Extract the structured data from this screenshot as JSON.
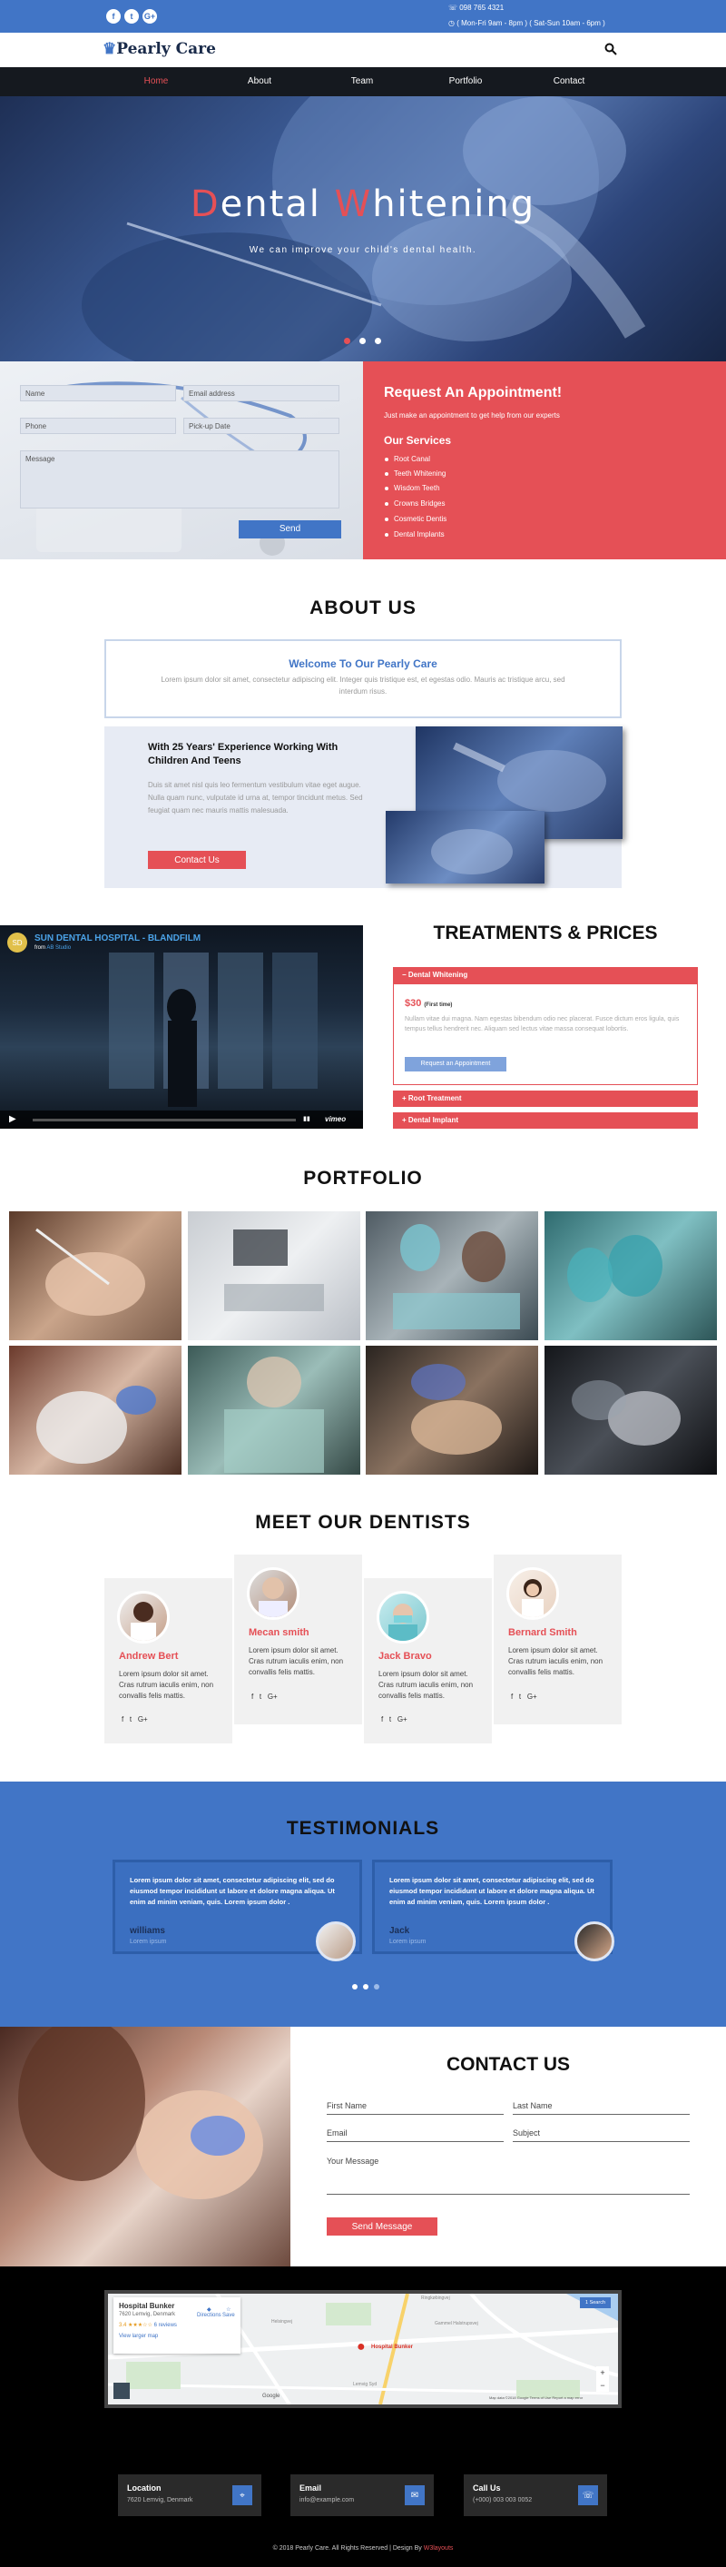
{
  "topbar": {
    "phone": "098 765 4321",
    "hours": "( Mon-Fri 9am - 8pm ) ( Sat-Sun 10am - 6pm )",
    "social": [
      "f",
      "t",
      "G+"
    ]
  },
  "header": {
    "logo": "Pearly Care",
    "search_icon": "search-icon"
  },
  "nav": {
    "items": [
      "Home",
      "About",
      "Team",
      "Portfolio",
      "Contact"
    ],
    "active": "Home"
  },
  "hero": {
    "title_first_letter_1": "D",
    "title_rest_1": "ental ",
    "title_first_letter_2": "W",
    "title_rest_2": "hitening",
    "subtitle": "We can improve your child's dental health."
  },
  "appointment": {
    "name_placeholder": "Name",
    "email_placeholder": "Email address",
    "phone_placeholder": "Phone",
    "pickup_placeholder": "Pick-up Date",
    "message_placeholder": "Message",
    "send_label": "Send",
    "heading": "Request An Appointment!",
    "subheading": "Just make an appointment to get help from our experts",
    "services_title": "Our Services",
    "services": [
      "Root Canal",
      "Teeth Whitening",
      "Wisdom Teeth",
      "Crowns Bridges",
      "Cosmetic Dentis",
      "Dental Implants"
    ]
  },
  "about": {
    "title": "ABOUT US",
    "welcome_title": "Welcome To Our Pearly Care",
    "welcome_text": "Lorem ipsum dolor sit amet, consectetur adipiscing elit. Integer quis tristique est, et egestas odio. Mauris ac tristique arcu, sed interdum risus.",
    "experience_title": "With 25 Years' Experience Working With Children And Teens",
    "experience_text": "Duis sit amet nisl quis leo fermentum vestibulum vitae eget augue. Nulla quam nunc, vulputate id urna at, tempor tincidunt metus. Sed feugiat quam nec mauris mattis malesuada.",
    "contact_label": "Contact Us"
  },
  "video": {
    "channel": "SUN DENTAL HOSPITAL - BLANDFILM",
    "from": "from",
    "from_name": "AB Studio",
    "brand": "vimeo"
  },
  "treatments": {
    "title": "TREATMENTS & PRICES",
    "items": [
      {
        "label": "Dental Whitening",
        "open": true
      },
      {
        "label": "Root Treatment",
        "open": false
      },
      {
        "label": "Dental Implant",
        "open": false
      }
    ],
    "price": "$30",
    "price_note": "(First time)",
    "desc": "Nullam vitae dui magna. Nam egestas bibendum odio nec placerat. Fusce dictum eros ligula, quis tempus tellus hendrerit nec. Aliquam sed lectus vitae massa consequat lobortis.",
    "request_label": "Request an Appointment"
  },
  "portfolio": {
    "title": "PORTFOLIO"
  },
  "dentists": {
    "title": "MEET OUR DENTISTS",
    "text": "Lorem ipsum dolor sit amet. Cras rutrum iaculis enim, non convallis felis mattis.",
    "list": [
      {
        "name": "Andrew Bert"
      },
      {
        "name": "Mecan smith"
      },
      {
        "name": "Jack Bravo"
      },
      {
        "name": "Bernard Smith"
      }
    ],
    "social": [
      "f",
      "t",
      "G+"
    ]
  },
  "testimonials": {
    "title": "TESTIMONIALS",
    "items": [
      {
        "text": "Lorem ipsum dolor sit amet, consectetur adipiscing elit, sed do eiusmod tempor incididunt ut labore et dolore magna aliqua. Ut enim ad minim veniam, quis. Lorem ipsum dolor .",
        "name": "williams",
        "role": "Lorem ipsum"
      },
      {
        "text": "Lorem ipsum dolor sit amet, consectetur adipiscing elit, sed do eiusmod tempor incididunt ut labore et dolore magna aliqua. Ut enim ad minim veniam, quis. Lorem ipsum dolor .",
        "name": "Jack",
        "role": "Lorem ipsum"
      }
    ]
  },
  "contact": {
    "title": "CONTACT US",
    "first_name": "First Name",
    "last_name": "Last Name",
    "email": "Email",
    "subject": "Subject",
    "message": "Your Message",
    "send_label": "Send Message"
  },
  "map": {
    "place": "Hospital Bunker",
    "address": "7620 Lemvig, Denmark",
    "rating": "3.4",
    "reviews": "6 reviews",
    "larger_map": "View larger map",
    "directions": "Directions",
    "save": "Save",
    "pin_label": "Hospital Bunker",
    "btn": "1 Search",
    "google": "Google",
    "footer_note": "Map data ©2018 Google   Terms of Use   Report a map error",
    "streets": [
      "Helsingvej",
      "Ringkøbingvej",
      "Gammel Halstrupsvej",
      "Lemvig Syd"
    ]
  },
  "info": [
    {
      "title": "Location",
      "value": "7620 Lemvig, Denmark",
      "icon": "map-marker-icon"
    },
    {
      "title": "Email",
      "value": "info@example.com",
      "icon": "envelope-icon"
    },
    {
      "title": "Call Us",
      "value": "(+000) 003 003 0052",
      "icon": "phone-icon"
    }
  ],
  "footer": {
    "text": "© 2018 Pearly Care. All Rights Reserved | Design By",
    "designer": "W3layouts"
  },
  "colors": {
    "blue": "#4175c6",
    "red": "#e55056",
    "dark": "#15191f"
  }
}
